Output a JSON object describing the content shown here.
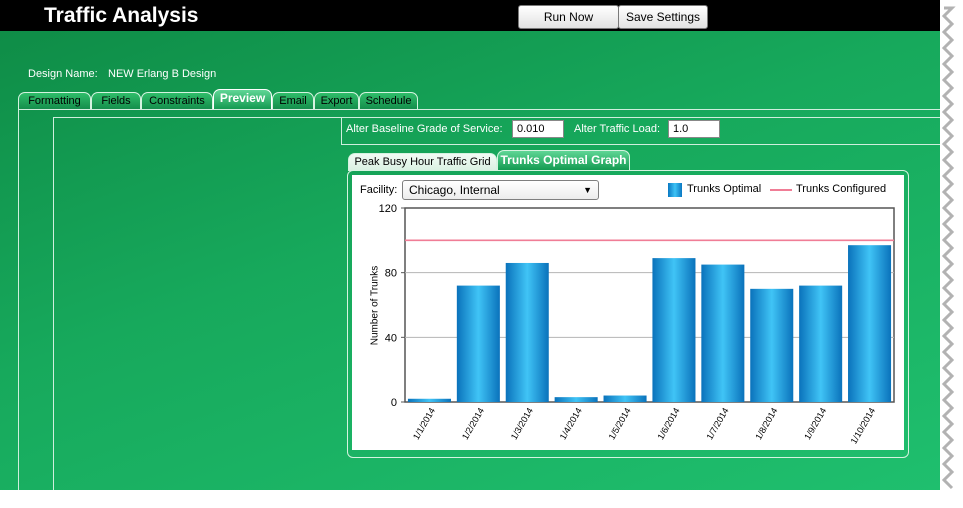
{
  "app": {
    "title": "Traffic Analysis",
    "run_now_label": "Run Now",
    "save_settings_label": "Save Settings",
    "design_name_label": "Design Name:",
    "design_name_value": "NEW Erlang B Design"
  },
  "tabs": [
    {
      "label": "Formatting",
      "active": false
    },
    {
      "label": "Fields",
      "active": false
    },
    {
      "label": "Constraints",
      "active": false
    },
    {
      "label": "Preview",
      "active": true
    },
    {
      "label": "Email",
      "active": false
    },
    {
      "label": "Export",
      "active": false
    },
    {
      "label": "Schedule",
      "active": false
    }
  ],
  "params": {
    "gos_label": "Alter Baseline Grade of Service:",
    "gos_value": "0.010",
    "load_label": "Alter Traffic Load:",
    "load_value": "1.0"
  },
  "subtabs": [
    {
      "label": "Peak Busy Hour Traffic Grid",
      "active": false
    },
    {
      "label": "Trunks Optimal Graph",
      "active": true
    }
  ],
  "chart_panel": {
    "facility_label": "Facility:",
    "facility_value": "Chicago, Internal"
  },
  "colors": {
    "accent_green": "#17a95c",
    "bar_blue": "#1a9ad9",
    "configured_line": "#f07d96"
  },
  "chart_data": {
    "type": "bar",
    "categories": [
      "1/1/2014",
      "1/2/2014",
      "1/3/2014",
      "1/4/2014",
      "1/5/2014",
      "1/6/2014",
      "1/7/2014",
      "1/8/2014",
      "1/9/2014",
      "1/10/2014"
    ],
    "series": [
      {
        "name": "Trunks Optimal",
        "values": [
          2,
          72,
          86,
          3,
          4,
          89,
          85,
          70,
          72,
          97
        ]
      },
      {
        "name": "Trunks Configured",
        "values": [
          100,
          100,
          100,
          100,
          100,
          100,
          100,
          100,
          100,
          100
        ]
      }
    ],
    "ylabel": "Number of Trunks",
    "xlabel": "",
    "ylim": [
      0,
      120
    ],
    "yticks": [
      0,
      40,
      80,
      120
    ],
    "grid": true,
    "legend": "top-right"
  }
}
